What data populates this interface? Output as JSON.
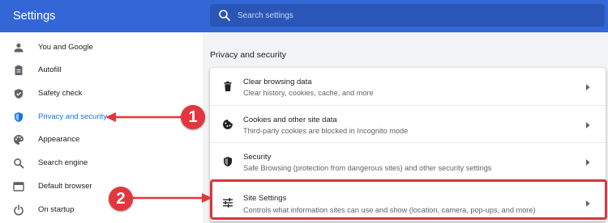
{
  "app": {
    "title": "Settings"
  },
  "search": {
    "placeholder": "Search settings"
  },
  "sidebar": {
    "items": [
      {
        "label": "You and Google"
      },
      {
        "label": "Autofill"
      },
      {
        "label": "Safety check"
      },
      {
        "label": "Privacy and security",
        "active": true
      },
      {
        "label": "Appearance"
      },
      {
        "label": "Search engine"
      },
      {
        "label": "Default browser"
      },
      {
        "label": "On startup"
      }
    ]
  },
  "section": {
    "title": "Privacy and security",
    "rows": [
      {
        "title": "Clear browsing data",
        "subtitle": "Clear history, cookies, cache, and more",
        "icon": "trash-icon"
      },
      {
        "title": "Cookies and other site data",
        "subtitle": "Third-party cookies are blocked in Incognito mode",
        "icon": "cookie-icon"
      },
      {
        "title": "Security",
        "subtitle": "Safe Browsing (protection from dangerous sites) and other security settings",
        "icon": "shield-icon"
      },
      {
        "title": "Site Settings",
        "subtitle": "Controls what information sites can use and show (location, camera, pop-ups, and more)",
        "icon": "tune-icon"
      }
    ]
  },
  "annotations": {
    "marker_1": "1",
    "marker_2": "2"
  },
  "colors": {
    "header": "#3367d6",
    "accent": "#1a73e8",
    "annotation": "#e2373f"
  }
}
